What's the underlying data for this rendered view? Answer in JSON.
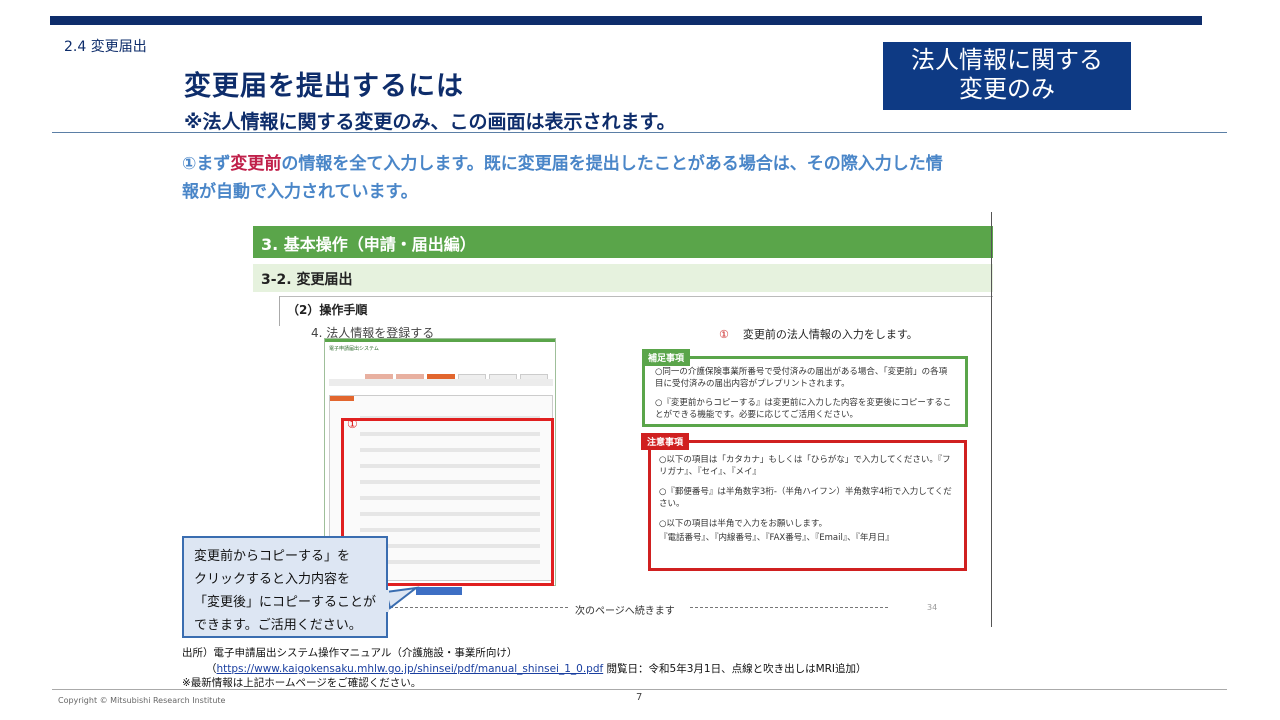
{
  "header": {
    "section_label": "2.4  変更届出",
    "title": "変更届を提出するには",
    "subtitle": "※法人情報に関する変更のみ、この画面は表示されます。",
    "badge_line1": "法人情報に関する",
    "badge_line2": "変更のみ"
  },
  "intro": {
    "prefix": "①まず",
    "emphasis": "変更前",
    "line1_rest": "の情報を全て入力します。既に変更届を提出したことがある場合は、その際入力した情",
    "line2": "報が自動で入力されています。"
  },
  "manual": {
    "heading1": "3. 基本操作（申請・届出編）",
    "heading2": "3-2. 変更届出",
    "step": "（2）操作手順",
    "substep": "4. 法人情報を登録する",
    "note_circle": "①",
    "note_text": "変更前の法人情報の入力をします。",
    "mini_brand": "電子申請届出システム",
    "supplement": {
      "label": "補足事項",
      "p1": "○同一の介護保険事業所番号で受付済みの届出がある場合、「変更前」の各項目に受付済みの届出内容がプレプリントされます。",
      "p2": "○『変更前からコピーする』は変更前に入力した内容を変更後にコピーすることができる機能です。必要に応じてご活用ください。"
    },
    "warning": {
      "label": "注意事項",
      "p1": "○以下の項目は「カタカナ」もしくは「ひらがな」で入力してください。『フリガナ』、『セイ』、『メイ』",
      "p2": "○『郵便番号』は半角数字3桁-（半角ハイフン）半角数字4桁で入力してください。",
      "p3a": "○以下の項目は半角で入力をお願いします。",
      "p3b": "『電話番号』、『内線番号』、『FAX番号』、『Email』、『年月日』"
    },
    "continue_text": "次のページへ続きます",
    "page_number": "34"
  },
  "callout": {
    "line1": "変更前からコピーする」を",
    "line2": "クリックすると入力内容を",
    "line3": "「変更後」にコピーすることが",
    "line4": "できます。ご活用ください。"
  },
  "source": {
    "line1": "出所）電子申請届出システム操作マニュアル（介護施設・事業所向け）",
    "link_open": "（",
    "link": "https://www.kaigokensaku.mhlw.go.jp/shinsei/pdf/manual_shinsei_1_0.pdf",
    "link_tail": " 閲覧日：令和5年3月1日、点線と吹き出しはMRI追加）",
    "note": "※最新情報は上記ホームページをご確認ください。"
  },
  "footer": {
    "copyright": "Copyright © Mitsubishi Research Institute",
    "page": "7"
  },
  "colors": {
    "navy": "#0e2d6b",
    "accent_blue": "#4a86c8",
    "emphasis_red": "#c0204a",
    "manual_green": "#5aa54a",
    "warning_red": "#d02020"
  }
}
